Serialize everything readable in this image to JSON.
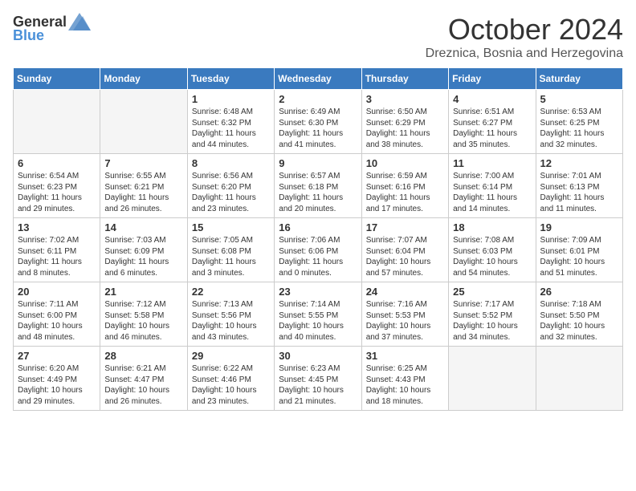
{
  "header": {
    "logo_general": "General",
    "logo_blue": "Blue",
    "month_title": "October 2024",
    "location": "Dreznica, Bosnia and Herzegovina"
  },
  "columns": [
    "Sunday",
    "Monday",
    "Tuesday",
    "Wednesday",
    "Thursday",
    "Friday",
    "Saturday"
  ],
  "weeks": [
    [
      {
        "day": "",
        "sunrise": "",
        "sunset": "",
        "daylight": "",
        "empty": true
      },
      {
        "day": "",
        "sunrise": "",
        "sunset": "",
        "daylight": "",
        "empty": true
      },
      {
        "day": "1",
        "sunrise": "Sunrise: 6:48 AM",
        "sunset": "Sunset: 6:32 PM",
        "daylight": "Daylight: 11 hours and 44 minutes.",
        "empty": false
      },
      {
        "day": "2",
        "sunrise": "Sunrise: 6:49 AM",
        "sunset": "Sunset: 6:30 PM",
        "daylight": "Daylight: 11 hours and 41 minutes.",
        "empty": false
      },
      {
        "day": "3",
        "sunrise": "Sunrise: 6:50 AM",
        "sunset": "Sunset: 6:29 PM",
        "daylight": "Daylight: 11 hours and 38 minutes.",
        "empty": false
      },
      {
        "day": "4",
        "sunrise": "Sunrise: 6:51 AM",
        "sunset": "Sunset: 6:27 PM",
        "daylight": "Daylight: 11 hours and 35 minutes.",
        "empty": false
      },
      {
        "day": "5",
        "sunrise": "Sunrise: 6:53 AM",
        "sunset": "Sunset: 6:25 PM",
        "daylight": "Daylight: 11 hours and 32 minutes.",
        "empty": false
      }
    ],
    [
      {
        "day": "6",
        "sunrise": "Sunrise: 6:54 AM",
        "sunset": "Sunset: 6:23 PM",
        "daylight": "Daylight: 11 hours and 29 minutes.",
        "empty": false
      },
      {
        "day": "7",
        "sunrise": "Sunrise: 6:55 AM",
        "sunset": "Sunset: 6:21 PM",
        "daylight": "Daylight: 11 hours and 26 minutes.",
        "empty": false
      },
      {
        "day": "8",
        "sunrise": "Sunrise: 6:56 AM",
        "sunset": "Sunset: 6:20 PM",
        "daylight": "Daylight: 11 hours and 23 minutes.",
        "empty": false
      },
      {
        "day": "9",
        "sunrise": "Sunrise: 6:57 AM",
        "sunset": "Sunset: 6:18 PM",
        "daylight": "Daylight: 11 hours and 20 minutes.",
        "empty": false
      },
      {
        "day": "10",
        "sunrise": "Sunrise: 6:59 AM",
        "sunset": "Sunset: 6:16 PM",
        "daylight": "Daylight: 11 hours and 17 minutes.",
        "empty": false
      },
      {
        "day": "11",
        "sunrise": "Sunrise: 7:00 AM",
        "sunset": "Sunset: 6:14 PM",
        "daylight": "Daylight: 11 hours and 14 minutes.",
        "empty": false
      },
      {
        "day": "12",
        "sunrise": "Sunrise: 7:01 AM",
        "sunset": "Sunset: 6:13 PM",
        "daylight": "Daylight: 11 hours and 11 minutes.",
        "empty": false
      }
    ],
    [
      {
        "day": "13",
        "sunrise": "Sunrise: 7:02 AM",
        "sunset": "Sunset: 6:11 PM",
        "daylight": "Daylight: 11 hours and 8 minutes.",
        "empty": false
      },
      {
        "day": "14",
        "sunrise": "Sunrise: 7:03 AM",
        "sunset": "Sunset: 6:09 PM",
        "daylight": "Daylight: 11 hours and 6 minutes.",
        "empty": false
      },
      {
        "day": "15",
        "sunrise": "Sunrise: 7:05 AM",
        "sunset": "Sunset: 6:08 PM",
        "daylight": "Daylight: 11 hours and 3 minutes.",
        "empty": false
      },
      {
        "day": "16",
        "sunrise": "Sunrise: 7:06 AM",
        "sunset": "Sunset: 6:06 PM",
        "daylight": "Daylight: 11 hours and 0 minutes.",
        "empty": false
      },
      {
        "day": "17",
        "sunrise": "Sunrise: 7:07 AM",
        "sunset": "Sunset: 6:04 PM",
        "daylight": "Daylight: 10 hours and 57 minutes.",
        "empty": false
      },
      {
        "day": "18",
        "sunrise": "Sunrise: 7:08 AM",
        "sunset": "Sunset: 6:03 PM",
        "daylight": "Daylight: 10 hours and 54 minutes.",
        "empty": false
      },
      {
        "day": "19",
        "sunrise": "Sunrise: 7:09 AM",
        "sunset": "Sunset: 6:01 PM",
        "daylight": "Daylight: 10 hours and 51 minutes.",
        "empty": false
      }
    ],
    [
      {
        "day": "20",
        "sunrise": "Sunrise: 7:11 AM",
        "sunset": "Sunset: 6:00 PM",
        "daylight": "Daylight: 10 hours and 48 minutes.",
        "empty": false
      },
      {
        "day": "21",
        "sunrise": "Sunrise: 7:12 AM",
        "sunset": "Sunset: 5:58 PM",
        "daylight": "Daylight: 10 hours and 46 minutes.",
        "empty": false
      },
      {
        "day": "22",
        "sunrise": "Sunrise: 7:13 AM",
        "sunset": "Sunset: 5:56 PM",
        "daylight": "Daylight: 10 hours and 43 minutes.",
        "empty": false
      },
      {
        "day": "23",
        "sunrise": "Sunrise: 7:14 AM",
        "sunset": "Sunset: 5:55 PM",
        "daylight": "Daylight: 10 hours and 40 minutes.",
        "empty": false
      },
      {
        "day": "24",
        "sunrise": "Sunrise: 7:16 AM",
        "sunset": "Sunset: 5:53 PM",
        "daylight": "Daylight: 10 hours and 37 minutes.",
        "empty": false
      },
      {
        "day": "25",
        "sunrise": "Sunrise: 7:17 AM",
        "sunset": "Sunset: 5:52 PM",
        "daylight": "Daylight: 10 hours and 34 minutes.",
        "empty": false
      },
      {
        "day": "26",
        "sunrise": "Sunrise: 7:18 AM",
        "sunset": "Sunset: 5:50 PM",
        "daylight": "Daylight: 10 hours and 32 minutes.",
        "empty": false
      }
    ],
    [
      {
        "day": "27",
        "sunrise": "Sunrise: 6:20 AM",
        "sunset": "Sunset: 4:49 PM",
        "daylight": "Daylight: 10 hours and 29 minutes.",
        "empty": false
      },
      {
        "day": "28",
        "sunrise": "Sunrise: 6:21 AM",
        "sunset": "Sunset: 4:47 PM",
        "daylight": "Daylight: 10 hours and 26 minutes.",
        "empty": false
      },
      {
        "day": "29",
        "sunrise": "Sunrise: 6:22 AM",
        "sunset": "Sunset: 4:46 PM",
        "daylight": "Daylight: 10 hours and 23 minutes.",
        "empty": false
      },
      {
        "day": "30",
        "sunrise": "Sunrise: 6:23 AM",
        "sunset": "Sunset: 4:45 PM",
        "daylight": "Daylight: 10 hours and 21 minutes.",
        "empty": false
      },
      {
        "day": "31",
        "sunrise": "Sunrise: 6:25 AM",
        "sunset": "Sunset: 4:43 PM",
        "daylight": "Daylight: 10 hours and 18 minutes.",
        "empty": false
      },
      {
        "day": "",
        "sunrise": "",
        "sunset": "",
        "daylight": "",
        "empty": true
      },
      {
        "day": "",
        "sunrise": "",
        "sunset": "",
        "daylight": "",
        "empty": true
      }
    ]
  ]
}
